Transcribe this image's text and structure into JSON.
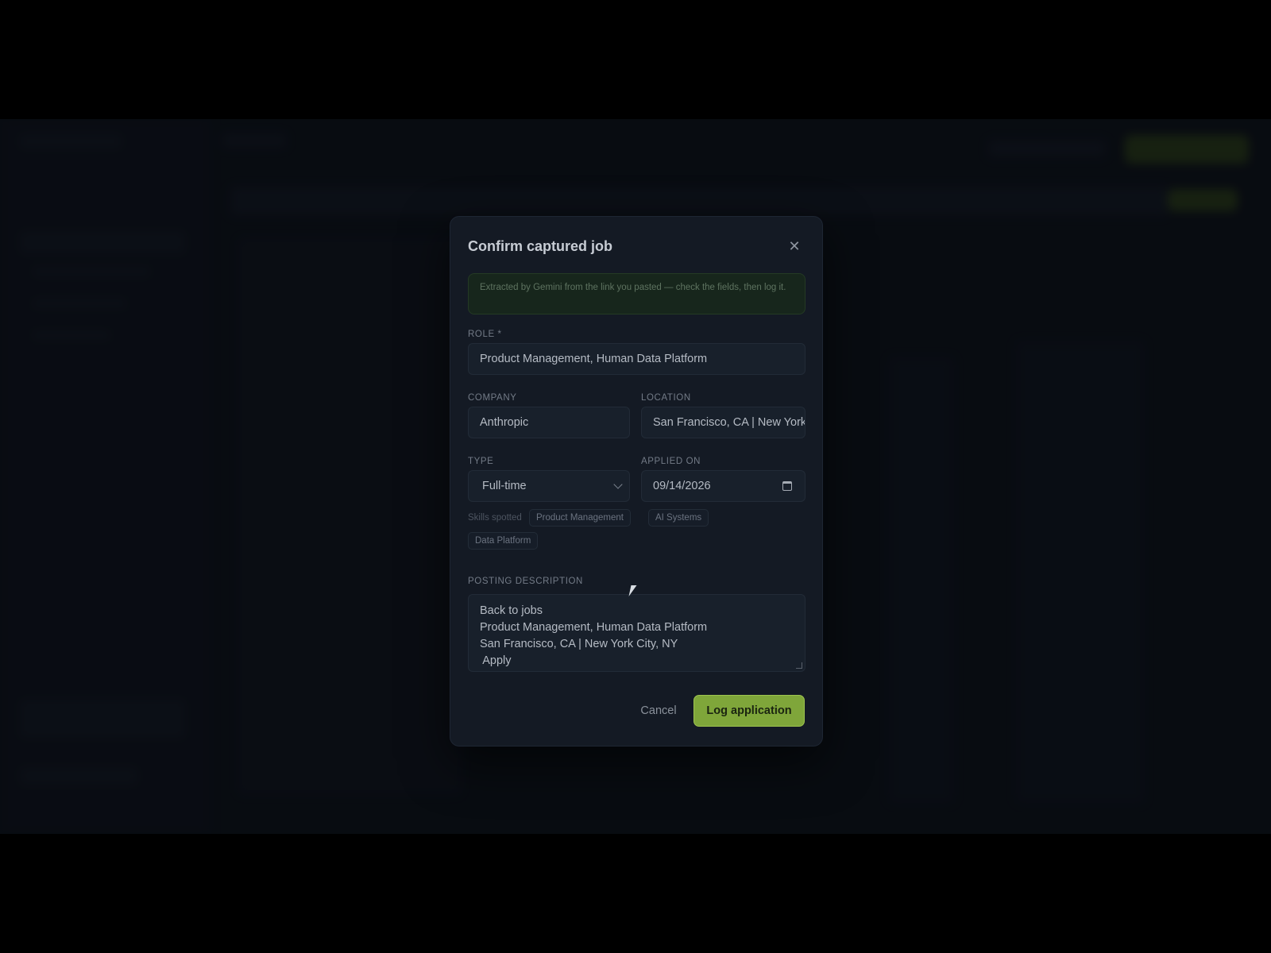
{
  "modal": {
    "title": "Confirm captured job",
    "notice": "Extracted by Gemini from the link you pasted — check the fields, then log it.",
    "role": {
      "label": "Role *",
      "value": "Product Management, Human Data Platform"
    },
    "company": {
      "label": "Company",
      "value": "Anthropic"
    },
    "location": {
      "label": "Location",
      "value": "San Francisco, CA | New York City, NY"
    },
    "type": {
      "label": "Type",
      "value": "Full-time"
    },
    "applied_on": {
      "label": "Applied on",
      "value": "09/14/2026"
    },
    "skills": {
      "label": "Skills spotted",
      "items": [
        "Product Management",
        "AI Systems",
        "Data Platform"
      ]
    },
    "description": {
      "label": "Posting description",
      "lines": [
        "Back to jobs",
        "Product Management, Human Data Platform",
        "San Francisco, CA | New York City, NY",
        " Apply"
      ]
    },
    "cancel_label": "Cancel",
    "submit_label": "Log application"
  },
  "icons": {
    "close": "close-icon",
    "select": "chevron-down-icon",
    "date": "calendar-icon"
  },
  "colors": {
    "accent": "#7fa63a",
    "modal_bg": "#141a24",
    "notice_bg": "#17261c"
  }
}
